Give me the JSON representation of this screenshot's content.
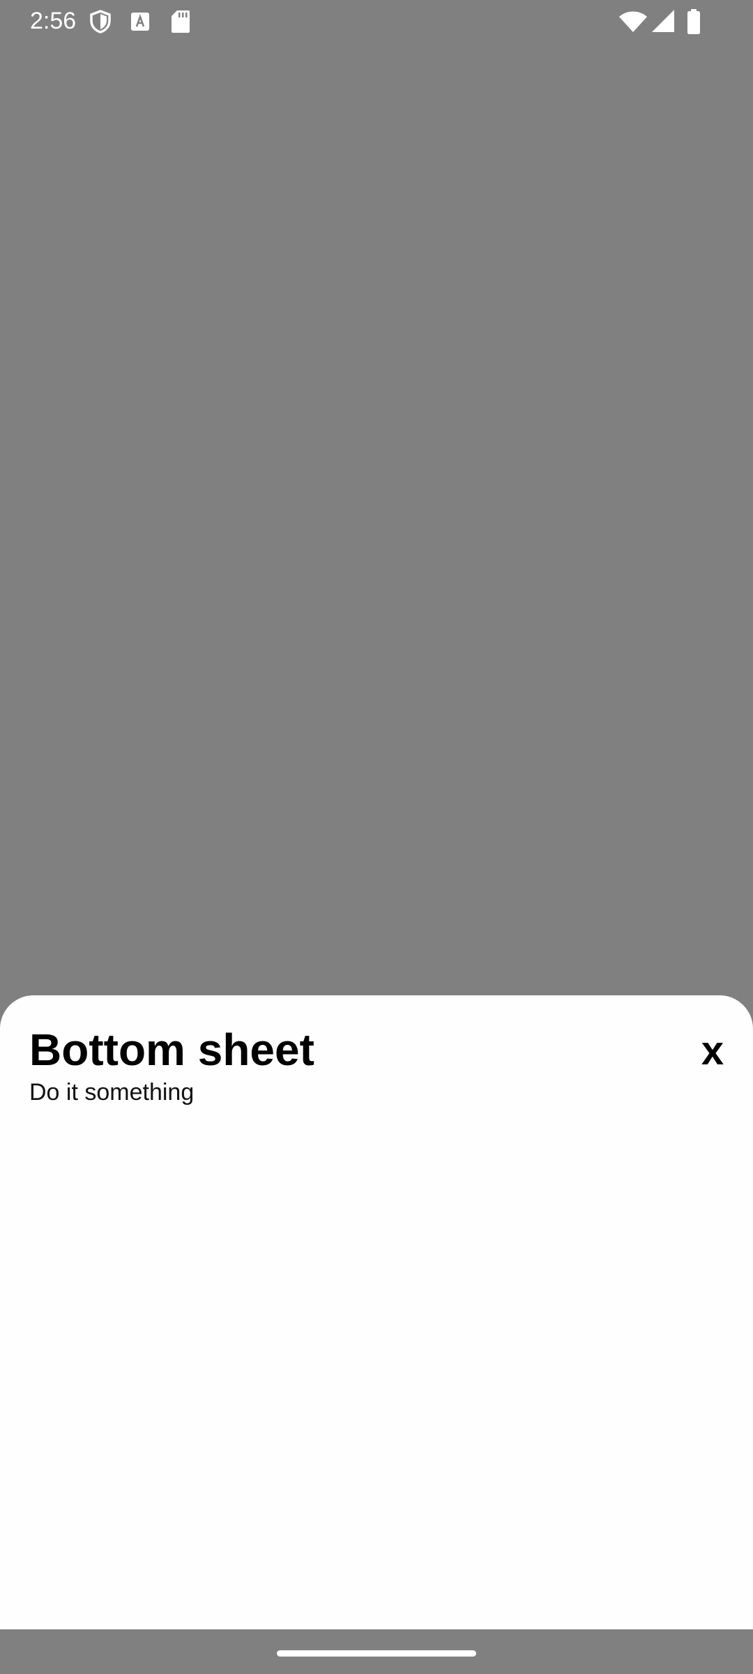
{
  "status_bar": {
    "time": "2:56",
    "icons_left": [
      "shield-icon",
      "font-a-icon",
      "sd-card-icon"
    ],
    "icons_right": [
      "wifi-icon",
      "cellular-signal-icon",
      "battery-icon"
    ]
  },
  "bottom_sheet": {
    "title": "Bottom sheet",
    "subtitle": "Do it something",
    "close_label": "x"
  },
  "colors": {
    "scrim": "#808080",
    "sheet_background": "#fefefe",
    "title_text": "#000000",
    "status_icons": "#ffffff"
  }
}
